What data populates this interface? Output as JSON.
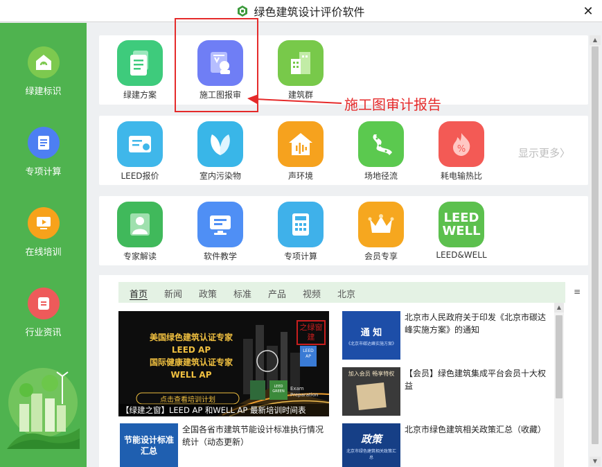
{
  "window": {
    "title": "绿色建筑设计评价软件",
    "close": "✕"
  },
  "sidebar": {
    "items": [
      {
        "label": "绿建标识"
      },
      {
        "label": "专项计算"
      },
      {
        "label": "在线培训"
      },
      {
        "label": "行业资讯"
      }
    ]
  },
  "row1": [
    {
      "label": "绿建方案",
      "color": "#3ecb7c"
    },
    {
      "label": "施工图报审",
      "color": "#6f7ef5"
    },
    {
      "label": "建筑群",
      "color": "#78c94a"
    }
  ],
  "row2": [
    {
      "label": "LEED报价",
      "color": "#3fb7ea"
    },
    {
      "label": "室内污染物",
      "color": "#39b6e8"
    },
    {
      "label": "声环境",
      "color": "#f6a21e"
    },
    {
      "label": "场地径流",
      "color": "#5bc94f"
    },
    {
      "label": "耗电输热比",
      "color": "#f35a55"
    }
  ],
  "more": "显示更多〉",
  "row3": [
    {
      "label": "专家解读",
      "color": "#40b95b"
    },
    {
      "label": "软件教学",
      "color": "#4f8ff5"
    },
    {
      "label": "专项计算",
      "color": "#3fb1ea"
    },
    {
      "label": "会员专享",
      "color": "#f6a71f"
    },
    {
      "label": "LEED&WELL",
      "color": "#5cc04e",
      "icon_text_1": "LEED",
      "icon_text_2": "WELL"
    }
  ],
  "annotation": "施工图审计报告",
  "news": {
    "tabs": [
      "首页",
      "新闻",
      "政策",
      "标准",
      "产品",
      "视频",
      "北京"
    ],
    "menu": "≡",
    "banner": {
      "line1": "美国绿色建筑认证专家",
      "line2": "LEED AP",
      "line3": "国际健康建筑认证专家",
      "line4": "WELL AP",
      "button": "点击查看培训计划",
      "badge1": "LEED AP",
      "badge2": "LEED GREEN",
      "badge3": "Exam Preparation",
      "stamp": "之绿窗建",
      "caption": "【绿建之窗】LEED AP 和WELL AP 最新培训时间表"
    },
    "items": [
      {
        "thumb_title": "通 知",
        "thumb_sub": "《北京市碳达峰实施方案》",
        "text": "北京市人民政府关于印发《北京市碳达峰实施方案》的通知"
      },
      {
        "thumb_title": "加入会员 畅享特权",
        "thumb_sub": "",
        "text": "【会员】绿色建筑集成平台会员十大权益"
      },
      {
        "thumb_title": "节能设计标准汇总",
        "thumb_sub": "",
        "text": "全国各省市建筑节能设计标准执行情况统计（动态更新）"
      },
      {
        "thumb_title": "政策",
        "thumb_sub": "北京市绿色建筑相关政策汇总",
        "text": "北京市绿色建筑相关政策汇总（收藏）"
      }
    ]
  }
}
